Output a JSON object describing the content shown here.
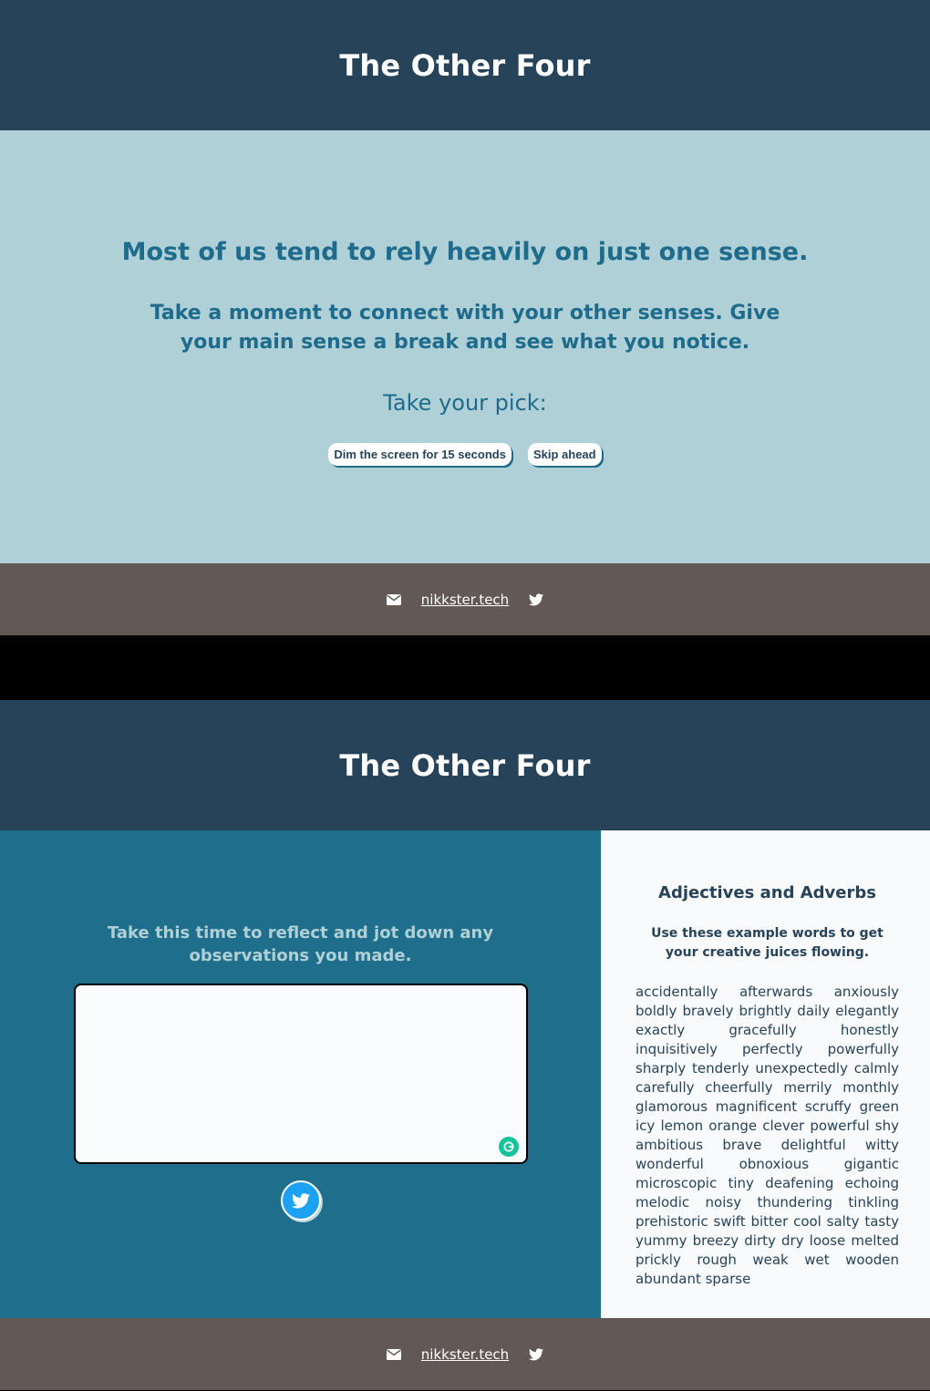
{
  "screen1": {
    "title": "The Other Four",
    "headline": "Most of us tend to rely heavily on just one sense.",
    "subheadline": "Take a moment to connect with your other senses. Give your main sense a break and see what you notice.",
    "pick_prompt": "Take your pick:",
    "buttons": {
      "dim": "Dim the screen for 15 seconds",
      "skip": "Skip ahead"
    },
    "footer": {
      "link": "nikkster.tech",
      "icons": [
        "envelope-icon",
        "twitter-icon"
      ]
    }
  },
  "screen2": {
    "title": "The Other Four",
    "reflect_prompt": "Take this time to reflect and jot down any observations you made.",
    "textarea": {
      "value": "",
      "placeholder": ""
    },
    "words_panel": {
      "title": "Adjectives and Adverbs",
      "subtitle": "Use these example words to get your creative juices flowing.",
      "words": "accidentally afterwards anxiously boldly bravely brightly daily elegantly exactly gracefully honestly inquisitively perfectly powerfully sharply tenderly unexpectedly calmly carefully cheerfully merrily monthly glamorous magnificent scruffy green icy lemon orange clever powerful shy ambitious brave delightful witty wonderful obnoxious gigantic microscopic tiny deafening echoing melodic noisy thundering tinkling prehistoric swift bitter cool salty tasty yummy breezy dirty dry loose melted prickly rough weak wet wooden abundant sparse"
    },
    "footer": {
      "link": "nikkster.tech"
    }
  },
  "colors": {
    "header_bg": "#27435a",
    "intro_bg": "#afd0d6",
    "accent_text": "#1f6b8c",
    "footer_bg": "#625957",
    "left_panel_bg": "#1f6e8c",
    "right_panel_bg": "#f8fafc",
    "twitter_blue": "#1da1f2",
    "grammarly_green": "#15c39a"
  }
}
